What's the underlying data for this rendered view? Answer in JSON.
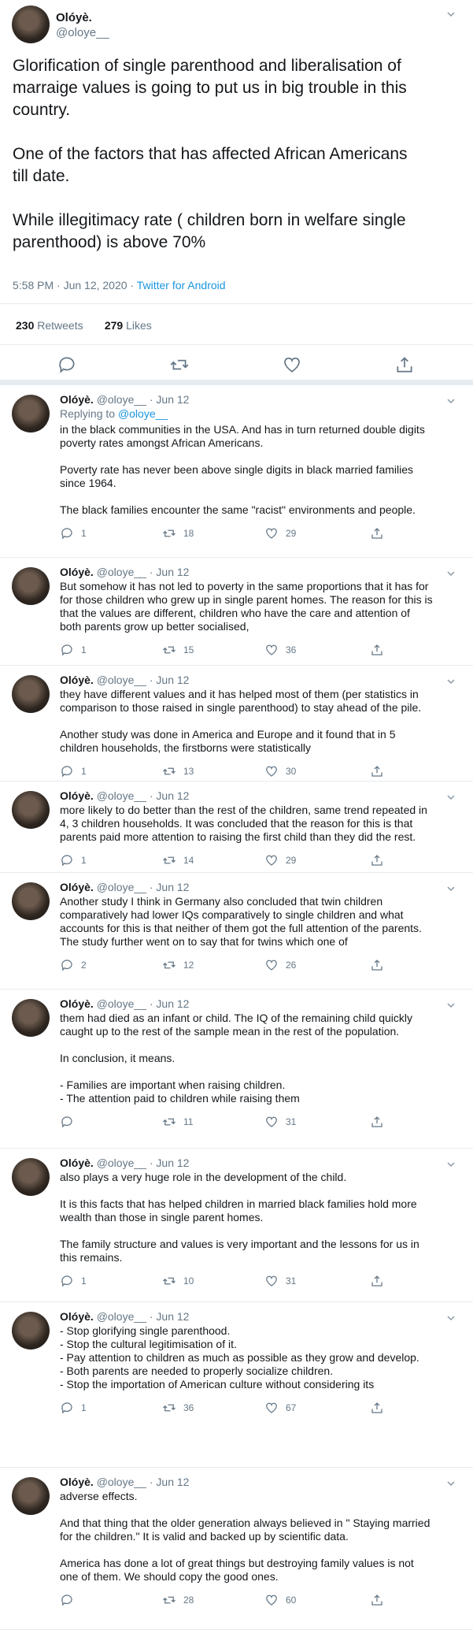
{
  "tweet": {
    "name": "Olóyè.",
    "handle": "@oloye__",
    "text": "Glorification of single parenthood and liberalisation of\nmarraige values is going to put us in big trouble in this\ncountry.\n\nOne of the factors that has affected African Americans\ntill date.\n\nWhile illegitimacy rate ( children born in welfare single\nparenthood) is above 70%",
    "time": "5:58 PM · Jun 12, 2020 · ",
    "source": "Twitter for Android",
    "retweets_count": "230",
    "retweets_label": "Retweets",
    "likes_count": "279",
    "likes_label": "Likes"
  },
  "icons": [
    "reply-icon",
    "retweet-icon",
    "like-icon",
    "share-icon",
    "chevron-down-icon"
  ],
  "colors": {
    "accent": "#1b95e0",
    "muted": "#657786",
    "divider": "#e6ecf0"
  },
  "replies": [
    {
      "name": "Olóyè.",
      "handle": "@oloye__",
      "date": "Jun 12",
      "replying_prefix": "Replying to ",
      "replying_to": "@oloye__",
      "text": "in the black communities in the USA. And has in turn returned double digits\npoverty rates amongst African Americans.\n\nPoverty rate has never been above single digits in black married families\nsince 1964.\n\nThe black families encounter the same \"racist\" environments and people.",
      "replies": "1",
      "retweets": "18",
      "likes": "29"
    },
    {
      "name": "Olóyè.",
      "handle": "@oloye__",
      "date": "Jun 12",
      "text": "But somehow it has not led to poverty in the same proportions that it has for\nfor those children who grew up in single parent homes. The reason for this is\nthat the values are different, children who have the care and attention of\nboth parents grow up better socialised,",
      "replies": "1",
      "retweets": "15",
      "likes": "36"
    },
    {
      "name": "Olóyè.",
      "handle": "@oloye__",
      "date": "Jun 12",
      "text": "they have different values and it has helped most of them (per statistics in\ncomparison to those raised in single parenthood) to stay ahead of the pile.\n\nAnother study was done in America and Europe and it found that in 5\nchildren households, the firstborns were statistically",
      "replies": "1",
      "retweets": "13",
      "likes": "30"
    },
    {
      "name": "Olóyè.",
      "handle": "@oloye__",
      "date": "Jun 12",
      "text": "more likely to do better than the rest of the children, same trend repeated in\n4, 3 children households. It was concluded that the reason for this is that\nparents paid more attention to raising the first child than they did the rest.",
      "replies": "1",
      "retweets": "14",
      "likes": "29"
    },
    {
      "name": "Olóyè.",
      "handle": "@oloye__",
      "date": "Jun 12",
      "text": "Another study I think in Germany also concluded that twin children\ncomparatively had lower IQs comparatively to single children and what\naccounts for this is that neither of them got the full attention of the parents.\nThe study further went on to say that for twins which one of",
      "replies": "2",
      "retweets": "12",
      "likes": "26"
    },
    {
      "name": "Olóyè.",
      "handle": "@oloye__",
      "date": "Jun 12",
      "text": "them had died as an infant or child. The IQ of the remaining child quickly\ncaught up to the rest of the sample mean in the rest of the population.\n\nIn conclusion, it means.\n\n- Families are important when raising children.\n- The attention paid to children while raising them",
      "replies": "",
      "retweets": "11",
      "likes": "31"
    },
    {
      "name": "Olóyè.",
      "handle": "@oloye__",
      "date": "Jun 12",
      "text": "also plays a very huge role in the development of the child.\n\nIt is this facts that has helped children in married black families hold more\nwealth than those in single parent homes.\n\nThe family structure and values is very important and the lessons for us in\nthis remains.",
      "replies": "1",
      "retweets": "10",
      "likes": "31"
    },
    {
      "name": "Olóyè.",
      "handle": "@oloye__",
      "date": "Jun 12",
      "text": "- Stop glorifying single parenthood.\n- Stop the cultural legitimisation of it.\n- Pay attention to children as much as possible as they grow and develop.\n- Both parents are needed to properly socialize children.\n- Stop the importation of American culture without considering its",
      "replies": "1",
      "retweets": "36",
      "likes": "67"
    },
    {
      "name": "Olóyè.",
      "handle": "@oloye__",
      "date": "Jun 12",
      "text": "adverse effects.\n\nAnd that thing that the older generation always believed in \" Staying married\nfor the children.\" It is valid and backed up by scientific data.\n\nAmerica has done a lot of great things but destroying family values is not\none of them. We should copy the good ones.",
      "replies": "",
      "retweets": "28",
      "likes": "60"
    }
  ]
}
